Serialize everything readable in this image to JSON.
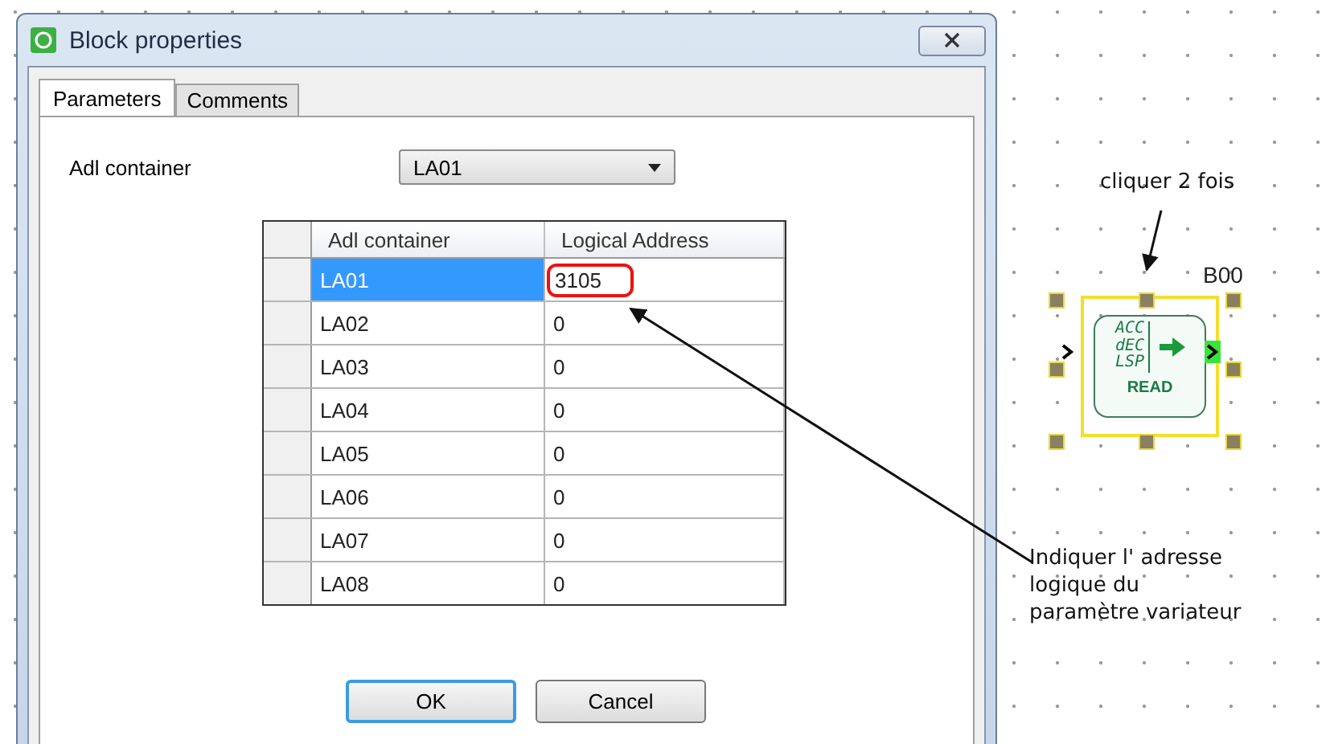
{
  "window": {
    "title": "Block properties"
  },
  "tabs": [
    {
      "label": "Parameters",
      "selected": true
    },
    {
      "label": "Comments",
      "selected": false
    }
  ],
  "adl_container": {
    "label": "Adl container",
    "value": "LA01"
  },
  "table": {
    "columns": [
      "Adl container",
      "Logical Address"
    ],
    "rows": [
      {
        "cells": [
          "LA01",
          "3105"
        ],
        "selected": true,
        "circled": true
      },
      {
        "cells": [
          "LA02",
          "0"
        ],
        "selected": false,
        "circled": false
      },
      {
        "cells": [
          "LA03",
          "0"
        ],
        "selected": false,
        "circled": false
      },
      {
        "cells": [
          "LA04",
          "0"
        ],
        "selected": false,
        "circled": false
      },
      {
        "cells": [
          "LA05",
          "0"
        ],
        "selected": false,
        "circled": false
      },
      {
        "cells": [
          "LA06",
          "0"
        ],
        "selected": false,
        "circled": false
      },
      {
        "cells": [
          "LA07",
          "0"
        ],
        "selected": false,
        "circled": false
      },
      {
        "cells": [
          "LA08",
          "0"
        ],
        "selected": false,
        "circled": false
      }
    ]
  },
  "buttons": [
    {
      "label": "OK",
      "default": true
    },
    {
      "label": "Cancel",
      "default": false
    }
  ],
  "canvas": {
    "block": {
      "name": "B00",
      "lines": [
        "ACC",
        "dEC",
        "LSP"
      ],
      "caption": "READ",
      "selected": true
    },
    "annotations": [
      {
        "lines": [
          "cliquer 2 fois"
        ]
      },
      {
        "lines": [
          "Indiquer l' adresse",
          "logique du",
          "paramètre variateur"
        ]
      }
    ]
  }
}
